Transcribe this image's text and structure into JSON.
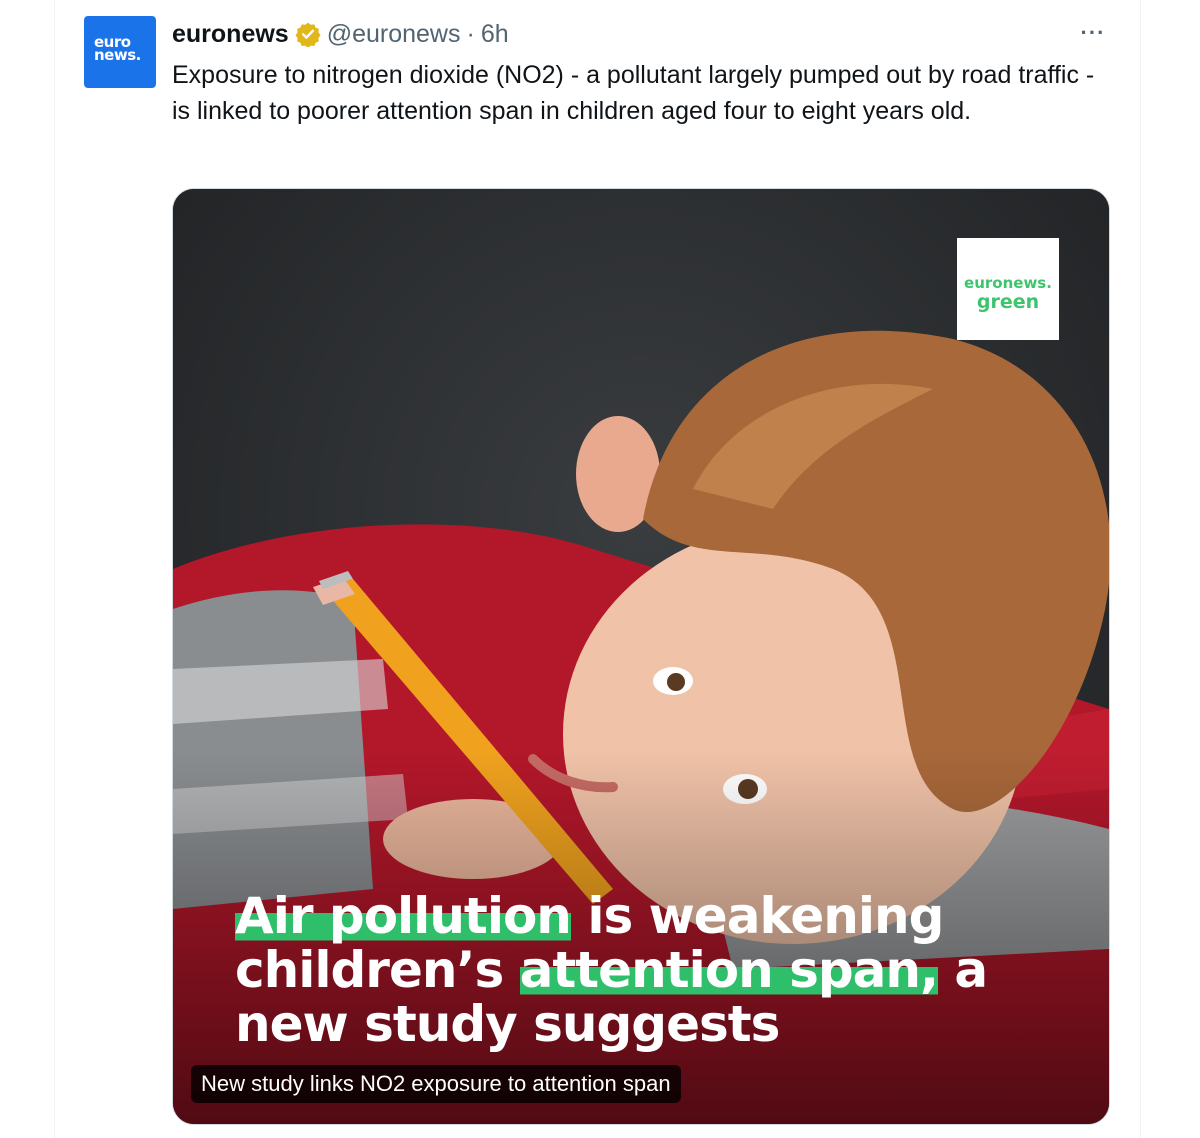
{
  "tweet": {
    "avatar_logo": "euro news.",
    "author_name": "euronews",
    "verified_icon": "gold-checkmark-badge-icon",
    "handle": "@euronews",
    "separator": "·",
    "timestamp": "6h",
    "more_icon": "more-horizontal-icon",
    "more_label": "···",
    "text": "Exposure to nitrogen dioxide (NO2) - a pollutant largely pumped out by road traffic - is linked to poorer attention span in children aged four to eight years old."
  },
  "media": {
    "description_image": "photo of a boy resting his head on a desk holding a pencil",
    "badge_line1": "euronews.",
    "badge_line2": "green",
    "headline_part1": "Air pollution",
    "headline_part2": " is weakening children’s ",
    "headline_part3": "attention span,",
    "headline_part4": " a new study suggests",
    "caption": "New study links NO2 exposure to attention span",
    "accent_color": "#2fbf6a",
    "avatar_color": "#1a73e8"
  }
}
